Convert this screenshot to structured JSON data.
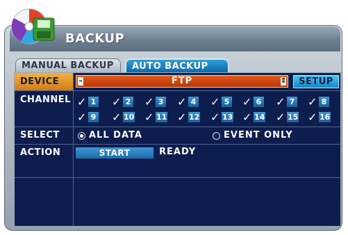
{
  "window": {
    "title": "BACKUP"
  },
  "tabs": [
    {
      "label": "MANUAL BACKUP",
      "active": false
    },
    {
      "label": "AUTO BACKUP",
      "active": true
    }
  ],
  "device": {
    "label": "DEVICE",
    "value": "FTP",
    "setup_label": "SETUP"
  },
  "channel": {
    "label": "CHANNEL",
    "items": [
      {
        "n": "1",
        "checked": true
      },
      {
        "n": "2",
        "checked": true
      },
      {
        "n": "3",
        "checked": true
      },
      {
        "n": "4",
        "checked": true
      },
      {
        "n": "5",
        "checked": true
      },
      {
        "n": "6",
        "checked": true
      },
      {
        "n": "7",
        "checked": true
      },
      {
        "n": "8",
        "checked": true
      },
      {
        "n": "9",
        "checked": true
      },
      {
        "n": "10",
        "checked": true
      },
      {
        "n": "11",
        "checked": true
      },
      {
        "n": "12",
        "checked": true
      },
      {
        "n": "13",
        "checked": true
      },
      {
        "n": "14",
        "checked": true
      },
      {
        "n": "15",
        "checked": true
      },
      {
        "n": "16",
        "checked": true
      }
    ]
  },
  "select": {
    "label": "SELECT",
    "options": [
      {
        "label": "ALL DATA",
        "selected": true
      },
      {
        "label": "EVENT ONLY",
        "selected": false
      }
    ]
  },
  "action": {
    "label": "ACTION",
    "start_label": "START",
    "status": "READY"
  },
  "colors": {
    "panel_bg": "#0d1e4e",
    "device_row": "#d27b1b",
    "active_tab": "#1a7fc0",
    "setup_button": "#1e9bd8"
  }
}
